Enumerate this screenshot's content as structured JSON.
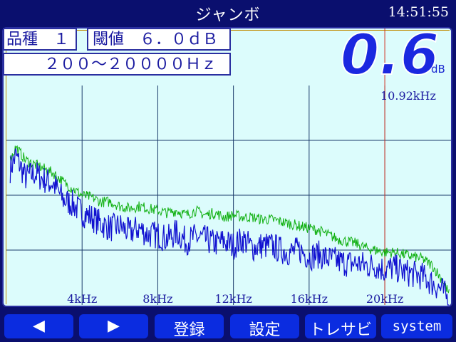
{
  "header": {
    "title": "ジャンボ",
    "time": "14:51:55"
  },
  "info": {
    "kind": "品種　１",
    "threshold": "閾値　６．０ｄＢ",
    "range": "２００～２００００Ｈｚ"
  },
  "reading": {
    "value": "0.6",
    "unit": "dB",
    "marker_freq": "10.92kHz"
  },
  "chart_data": {
    "type": "line",
    "x_unit": "kHz",
    "xlim": [
      0,
      23.5
    ],
    "ylim": [
      0,
      1
    ],
    "x_ticks": [
      4,
      8,
      12,
      16,
      20
    ],
    "x_tick_labels": [
      "4kHz",
      "8kHz",
      "12kHz",
      "16kHz",
      "20kHz"
    ],
    "grid": true,
    "marker_x": 20.0,
    "colors": {
      "series_blue": "#1010d0",
      "series_green": "#10b010",
      "grid": "#1a3a6a",
      "marker": "#d03020"
    },
    "series": [
      {
        "color": "#1010d0",
        "x": [
          0.2,
          0.5,
          1,
          1.5,
          2,
          2.5,
          3,
          3.5,
          4,
          4.5,
          5,
          5.5,
          6,
          6.5,
          7,
          7.5,
          8,
          8.5,
          9,
          9.5,
          10,
          10.5,
          11,
          11.5,
          12,
          12.5,
          13,
          13.5,
          14,
          14.5,
          15,
          15.5,
          16,
          16.5,
          17,
          17.5,
          18,
          18.5,
          19,
          19.5,
          20,
          20.5,
          21,
          21.5,
          22,
          22.5,
          23,
          23.4
        ],
        "y": [
          0.62,
          0.68,
          0.58,
          0.6,
          0.57,
          0.55,
          0.48,
          0.46,
          0.42,
          0.4,
          0.37,
          0.35,
          0.36,
          0.33,
          0.35,
          0.32,
          0.32,
          0.3,
          0.33,
          0.29,
          0.31,
          0.3,
          0.28,
          0.29,
          0.27,
          0.3,
          0.26,
          0.27,
          0.27,
          0.25,
          0.24,
          0.25,
          0.22,
          0.23,
          0.21,
          0.2,
          0.19,
          0.19,
          0.18,
          0.18,
          0.16,
          0.17,
          0.15,
          0.14,
          0.13,
          0.1,
          0.07,
          0.02
        ]
      },
      {
        "color": "#10b010",
        "x": [
          0.2,
          0.5,
          1,
          1.5,
          2,
          2.5,
          3,
          3.5,
          4,
          4.5,
          5,
          5.5,
          6,
          6.5,
          7,
          7.5,
          8,
          8.5,
          9,
          9.5,
          10,
          10.5,
          11,
          11.5,
          12,
          12.5,
          13,
          13.5,
          14,
          14.5,
          15,
          15.5,
          16,
          16.5,
          17,
          17.5,
          18,
          18.5,
          19,
          19.5,
          20,
          20.5,
          21,
          21.5,
          22,
          22.5,
          23,
          23.4
        ],
        "y": [
          0.66,
          0.72,
          0.66,
          0.64,
          0.62,
          0.6,
          0.56,
          0.53,
          0.5,
          0.49,
          0.47,
          0.47,
          0.45,
          0.44,
          0.45,
          0.44,
          0.43,
          0.42,
          0.43,
          0.41,
          0.43,
          0.41,
          0.42,
          0.4,
          0.41,
          0.4,
          0.4,
          0.39,
          0.39,
          0.38,
          0.37,
          0.36,
          0.35,
          0.34,
          0.32,
          0.3,
          0.29,
          0.28,
          0.26,
          0.25,
          0.24,
          0.24,
          0.23,
          0.22,
          0.21,
          0.18,
          0.12,
          0.05
        ]
      }
    ]
  },
  "buttons": {
    "prev": "◀",
    "next": "▶",
    "register": "登録",
    "settings": "設定",
    "trace_sub": "トレサビ",
    "system": "system"
  }
}
